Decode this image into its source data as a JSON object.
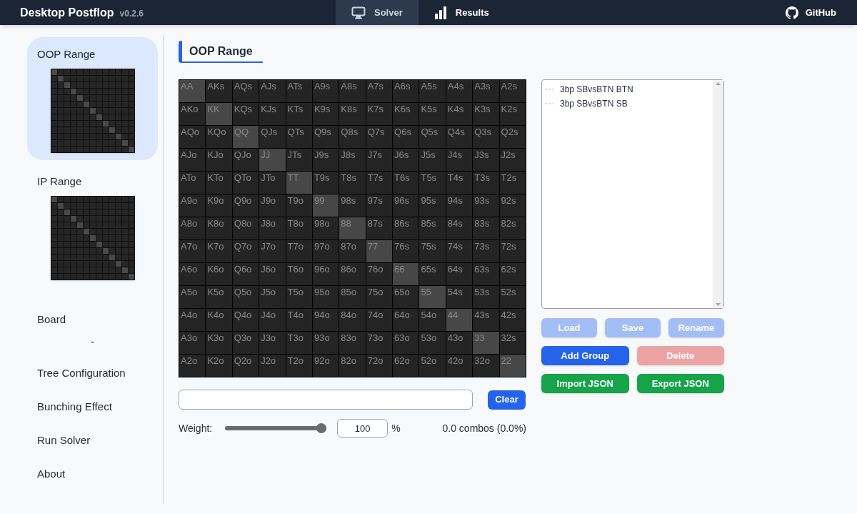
{
  "app": {
    "title": "Desktop Postflop",
    "version": "v0.2.6"
  },
  "nav": [
    {
      "label": "Solver",
      "kind": "monitor",
      "selected": true
    },
    {
      "label": "Results",
      "kind": "bars",
      "selected": false
    }
  ],
  "github": {
    "label": "GitHub"
  },
  "sidebar": [
    {
      "label": "OOP Range",
      "kind": "range",
      "selected": true
    },
    {
      "label": "IP Range",
      "kind": "range",
      "selected": false
    },
    {
      "label": "Board",
      "kind": "board",
      "value": "-",
      "selected": false
    },
    {
      "label": "Tree Configuration",
      "kind": "plain",
      "selected": false
    },
    {
      "label": "Bunching Effect",
      "kind": "plain",
      "selected": false
    },
    {
      "label": "Run Solver",
      "kind": "plain",
      "selected": false
    },
    {
      "label": "About",
      "kind": "plain",
      "selected": false
    }
  ],
  "heading": "OOP Range",
  "grid": [
    [
      "AA",
      "AKs",
      "AQs",
      "AJs",
      "ATs",
      "A9s",
      "A8s",
      "A7s",
      "A6s",
      "A5s",
      "A4s",
      "A3s",
      "A2s"
    ],
    [
      "AKo",
      "KK",
      "KQs",
      "KJs",
      "KTs",
      "K9s",
      "K8s",
      "K7s",
      "K6s",
      "K5s",
      "K4s",
      "K3s",
      "K2s"
    ],
    [
      "AQo",
      "KQo",
      "QQ",
      "QJs",
      "QTs",
      "Q9s",
      "Q8s",
      "Q7s",
      "Q6s",
      "Q5s",
      "Q4s",
      "Q3s",
      "Q2s"
    ],
    [
      "AJo",
      "KJo",
      "QJo",
      "JJ",
      "JTs",
      "J9s",
      "J8s",
      "J7s",
      "J6s",
      "J5s",
      "J4s",
      "J3s",
      "J2s"
    ],
    [
      "ATo",
      "KTo",
      "QTo",
      "JTo",
      "TT",
      "T9s",
      "T8s",
      "T7s",
      "T6s",
      "T5s",
      "T4s",
      "T3s",
      "T2s"
    ],
    [
      "A9o",
      "K9o",
      "Q9o",
      "J9o",
      "T9o",
      "99",
      "98s",
      "97s",
      "96s",
      "95s",
      "94s",
      "93s",
      "92s"
    ],
    [
      "A8o",
      "K8o",
      "Q8o",
      "J8o",
      "T8o",
      "98o",
      "88",
      "87s",
      "86s",
      "85s",
      "84s",
      "83s",
      "82s"
    ],
    [
      "A7o",
      "K7o",
      "Q7o",
      "J7o",
      "T7o",
      "97o",
      "87o",
      "77",
      "76s",
      "75s",
      "74s",
      "73s",
      "72s"
    ],
    [
      "A6o",
      "K6o",
      "Q6o",
      "J6o",
      "T6o",
      "96o",
      "86o",
      "76o",
      "66",
      "65s",
      "64s",
      "63s",
      "62s"
    ],
    [
      "A5o",
      "K5o",
      "Q5o",
      "J5o",
      "T5o",
      "95o",
      "85o",
      "75o",
      "65o",
      "55",
      "54s",
      "53s",
      "52s"
    ],
    [
      "A4o",
      "K4o",
      "Q4o",
      "J4o",
      "T4o",
      "94o",
      "84o",
      "74o",
      "64o",
      "54o",
      "44",
      "43s",
      "42s"
    ],
    [
      "A3o",
      "K3o",
      "Q3o",
      "J3o",
      "T3o",
      "93o",
      "83o",
      "73o",
      "63o",
      "53o",
      "43o",
      "33",
      "32s"
    ],
    [
      "A2o",
      "K2o",
      "Q2o",
      "J2o",
      "T2o",
      "92o",
      "82o",
      "72o",
      "62o",
      "52o",
      "42o",
      "32o",
      "22"
    ]
  ],
  "clear_button": "Clear",
  "weight": {
    "label": "Weight:",
    "level": 1.0,
    "value": "100",
    "unit": "%"
  },
  "combos": "0.0 combos (0.0%)",
  "tree": [
    {
      "label": "3bp SBvsBTN BTN",
      "selected": false
    },
    {
      "label": "3bp SBvsBTN SB",
      "selected": false
    }
  ],
  "buttons": [
    {
      "label": "Load",
      "kind": "blue",
      "disabled": true
    },
    {
      "label": "Save",
      "kind": "blue",
      "disabled": true
    },
    {
      "label": "Rename",
      "kind": "blue",
      "disabled": true
    },
    {
      "label": "Add Group",
      "kind": "blue",
      "disabled": false
    },
    {
      "label": "Delete",
      "kind": "red",
      "disabled": true
    },
    {
      "label": "Import JSON",
      "kind": "green",
      "disabled": false
    },
    {
      "label": "Export JSON",
      "kind": "green",
      "disabled": false
    }
  ]
}
